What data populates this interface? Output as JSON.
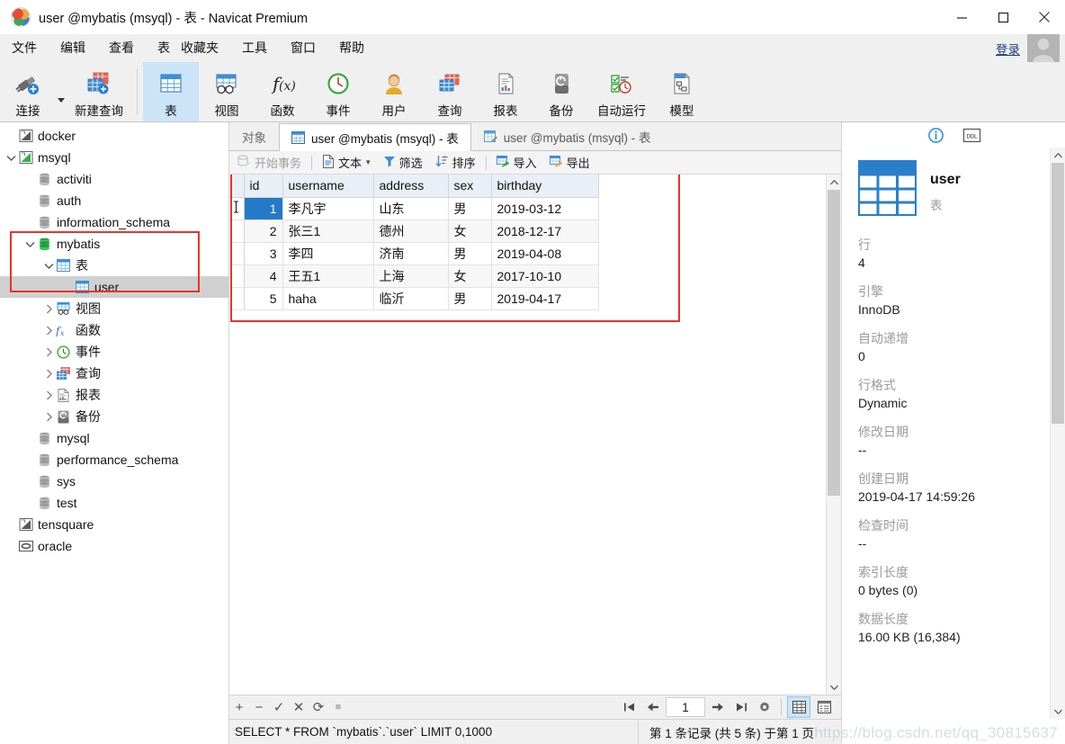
{
  "window": {
    "title": "user @mybatis (msyql) - 表 - Navicat Premium",
    "minimize_label": "最小化",
    "maximize_label": "最大化",
    "close_label": "关闭"
  },
  "menubar": {
    "items": [
      "文件",
      "编辑",
      "查看",
      "表",
      "收藏夹",
      "工具",
      "窗口",
      "帮助"
    ],
    "login_label": "登录"
  },
  "toolbar": {
    "items": [
      {
        "label": "连接",
        "icon": "connection-icon",
        "active": false
      },
      {
        "label": "新建查询",
        "icon": "new-query-icon",
        "active": false
      },
      {
        "label": "表",
        "icon": "table-icon",
        "active": true
      },
      {
        "label": "视图",
        "icon": "view-icon",
        "active": false
      },
      {
        "label": "函数",
        "icon": "function-icon",
        "active": false
      },
      {
        "label": "事件",
        "icon": "event-icon",
        "active": false
      },
      {
        "label": "用户",
        "icon": "user-icon",
        "active": false
      },
      {
        "label": "查询",
        "icon": "query-icon",
        "active": false
      },
      {
        "label": "报表",
        "icon": "report-icon",
        "active": false
      },
      {
        "label": "备份",
        "icon": "backup-icon",
        "active": false
      },
      {
        "label": "自动运行",
        "icon": "automation-icon",
        "active": false
      },
      {
        "label": "模型",
        "icon": "model-icon",
        "active": false
      }
    ]
  },
  "sidebar": {
    "tree": [
      {
        "label": "docker",
        "depth": 0,
        "icon": "connection-node-icon",
        "chevron": "none",
        "selected": false
      },
      {
        "label": "msyql",
        "depth": 0,
        "icon": "connection-open-icon",
        "chevron": "expanded",
        "selected": false
      },
      {
        "label": "activiti",
        "depth": 1,
        "icon": "database-icon",
        "chevron": "none",
        "selected": false
      },
      {
        "label": "auth",
        "depth": 1,
        "icon": "database-icon",
        "chevron": "none",
        "selected": false
      },
      {
        "label": "information_schema",
        "depth": 1,
        "icon": "database-icon",
        "chevron": "none",
        "selected": false
      },
      {
        "label": "mybatis",
        "depth": 1,
        "icon": "database-open-icon",
        "chevron": "expanded",
        "selected": false
      },
      {
        "label": "表",
        "depth": 2,
        "icon": "table-folder-icon",
        "chevron": "expanded",
        "selected": false
      },
      {
        "label": "user",
        "depth": 3,
        "icon": "table-icon",
        "chevron": "none",
        "selected": true
      },
      {
        "label": "视图",
        "depth": 2,
        "icon": "views-folder-icon",
        "chevron": "collapsed",
        "selected": false
      },
      {
        "label": "函数",
        "depth": 2,
        "icon": "functions-folder-icon",
        "chevron": "collapsed",
        "selected": false
      },
      {
        "label": "事件",
        "depth": 2,
        "icon": "events-folder-icon",
        "chevron": "collapsed",
        "selected": false
      },
      {
        "label": "查询",
        "depth": 2,
        "icon": "queries-folder-icon",
        "chevron": "collapsed",
        "selected": false
      },
      {
        "label": "报表",
        "depth": 2,
        "icon": "reports-folder-icon",
        "chevron": "collapsed",
        "selected": false
      },
      {
        "label": "备份",
        "depth": 2,
        "icon": "backups-folder-icon",
        "chevron": "collapsed",
        "selected": false
      },
      {
        "label": "mysql",
        "depth": 1,
        "icon": "database-icon",
        "chevron": "none",
        "selected": false
      },
      {
        "label": "performance_schema",
        "depth": 1,
        "icon": "database-icon",
        "chevron": "none",
        "selected": false
      },
      {
        "label": "sys",
        "depth": 1,
        "icon": "database-icon",
        "chevron": "none",
        "selected": false
      },
      {
        "label": "test",
        "depth": 1,
        "icon": "database-icon",
        "chevron": "none",
        "selected": false
      },
      {
        "label": "tensquare",
        "depth": 0,
        "icon": "connection-node-icon",
        "chevron": "none",
        "selected": false
      },
      {
        "label": "oracle",
        "depth": 0,
        "icon": "oracle-node-icon",
        "chevron": "none",
        "selected": false
      }
    ]
  },
  "tabs": [
    {
      "label": "对象",
      "icon": "none",
      "active": false
    },
    {
      "label": "user @mybatis (msyql) - 表",
      "icon": "table-icon",
      "active": true
    },
    {
      "label": "user @mybatis (msyql) - 表",
      "icon": "design-icon",
      "active": false
    }
  ],
  "grid_toolbar": {
    "items": [
      {
        "label": "开始事务",
        "icon": "transaction-icon",
        "disabled": true,
        "caret": false
      },
      {
        "label": "文本",
        "icon": "text-icon",
        "disabled": false,
        "caret": true
      },
      {
        "label": "筛选",
        "icon": "filter-icon",
        "disabled": false,
        "caret": false
      },
      {
        "label": "排序",
        "icon": "sort-icon",
        "disabled": false,
        "caret": false
      },
      {
        "label": "导入",
        "icon": "import-icon",
        "disabled": false,
        "caret": false
      },
      {
        "label": "导出",
        "icon": "export-icon",
        "disabled": false,
        "caret": false
      }
    ]
  },
  "grid": {
    "columns": [
      "id",
      "username",
      "address",
      "sex",
      "birthday"
    ],
    "rows": [
      {
        "id": "1",
        "username": "李凡宇",
        "address": "山东",
        "sex": "男",
        "birthday": "2019-03-12"
      },
      {
        "id": "2",
        "username": "张三1",
        "address": "德州",
        "sex": "女",
        "birthday": "2018-12-17"
      },
      {
        "id": "3",
        "username": "李四",
        "address": "济南",
        "sex": "男",
        "birthday": "2019-04-08"
      },
      {
        "id": "4",
        "username": "王五1",
        "address": "上海",
        "sex": "女",
        "birthday": "2017-10-10"
      },
      {
        "id": "5",
        "username": "haha",
        "address": "临沂",
        "sex": "男",
        "birthday": "2019-04-17"
      }
    ],
    "selected_cell": {
      "row": 0,
      "column": "id"
    }
  },
  "record_toolbar": {
    "buttons": [
      {
        "name": "add-record",
        "glyph": "+"
      },
      {
        "name": "delete-record",
        "glyph": "−"
      },
      {
        "name": "apply-change",
        "glyph": "✓"
      },
      {
        "name": "cancel-change",
        "glyph": "✕"
      },
      {
        "name": "refresh",
        "glyph": "⟳"
      },
      {
        "name": "stop",
        "glyph": "■"
      }
    ]
  },
  "pager": {
    "first_label": "第一页",
    "prev_label": "上一页",
    "page_value": "1",
    "next_label": "下一页",
    "last_label": "最后一页",
    "settings_label": "设置",
    "grid_view_label": "网格查看",
    "form_view_label": "表单查看"
  },
  "statusbar": {
    "sql": "SELECT * FROM `mybatis`.`user` LIMIT 0,1000",
    "record_info": "第 1 条记录 (共 5 条) 于第 1 页"
  },
  "info_panel": {
    "tab_info_label": "信息",
    "tab_ddl_label": "DDL",
    "object_name": "user",
    "object_type": "表",
    "fields": [
      {
        "key": "行",
        "value": "4"
      },
      {
        "key": "引擎",
        "value": "InnoDB"
      },
      {
        "key": "自动递增",
        "value": "0"
      },
      {
        "key": "行格式",
        "value": "Dynamic"
      },
      {
        "key": "修改日期",
        "value": "--"
      },
      {
        "key": "创建日期",
        "value": "2019-04-17 14:59:26"
      },
      {
        "key": "检查时间",
        "value": "--"
      },
      {
        "key": "索引长度",
        "value": "0 bytes (0)"
      },
      {
        "key": "数据长度",
        "value": "16.00 KB (16,384)"
      }
    ]
  },
  "watermark": {
    "text": "https://blog.csdn.net/qq_30815637"
  },
  "colors": {
    "accent": "#2579c9",
    "active_toolbar_bg": "#cce4f7",
    "highlight_box": "#e8332a",
    "selection_gray": "#d0d0d0",
    "header_bg": "#e9eff7"
  }
}
